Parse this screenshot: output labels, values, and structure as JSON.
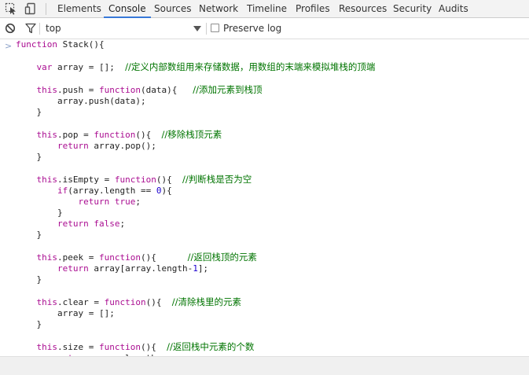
{
  "devtools": {
    "tabs": [
      {
        "label": "Elements"
      },
      {
        "label": "Console",
        "active": true
      },
      {
        "label": "Sources"
      },
      {
        "label": "Network"
      },
      {
        "label": "Timeline"
      },
      {
        "label": "Profiles"
      },
      {
        "label": "Resources"
      },
      {
        "label": "Security"
      },
      {
        "label": "Audits"
      }
    ],
    "icons": [
      "inspect-element-icon",
      "device-mode-icon"
    ]
  },
  "console_toolbar": {
    "context": "top",
    "preserve_log_label": "Preserve log",
    "preserve_log_checked": false,
    "icons": [
      "clear-console-icon",
      "filter-icon",
      "dropdown-arrow-icon"
    ]
  },
  "console": {
    "lines": [
      [
        {
          "t": "function",
          "c": "kw"
        },
        {
          "t": " Stack(){"
        }
      ],
      [],
      [
        {
          "t": "    "
        },
        {
          "t": "var",
          "c": "kw"
        },
        {
          "t": " array = [];  "
        },
        {
          "t": "//定义内部数组用来存储数据，用数组的末端来模拟堆栈的顶端",
          "c": "cm"
        }
      ],
      [],
      [
        {
          "t": "    "
        },
        {
          "t": "this",
          "c": "kw"
        },
        {
          "t": ".push = "
        },
        {
          "t": "function",
          "c": "kw"
        },
        {
          "t": "(data){   "
        },
        {
          "t": "//添加元素到栈顶",
          "c": "cm"
        }
      ],
      [
        {
          "t": "        array.push(data);"
        }
      ],
      [
        {
          "t": "    }"
        }
      ],
      [],
      [
        {
          "t": "    "
        },
        {
          "t": "this",
          "c": "kw"
        },
        {
          "t": ".pop = "
        },
        {
          "t": "function",
          "c": "kw"
        },
        {
          "t": "(){  "
        },
        {
          "t": "//移除栈顶元素",
          "c": "cm"
        }
      ],
      [
        {
          "t": "        "
        },
        {
          "t": "return",
          "c": "kw"
        },
        {
          "t": " array.pop();"
        }
      ],
      [
        {
          "t": "    }"
        }
      ],
      [],
      [
        {
          "t": "    "
        },
        {
          "t": "this",
          "c": "kw"
        },
        {
          "t": ".isEmpty = "
        },
        {
          "t": "function",
          "c": "kw"
        },
        {
          "t": "(){  "
        },
        {
          "t": "//判断栈是否为空",
          "c": "cm"
        }
      ],
      [
        {
          "t": "        "
        },
        {
          "t": "if",
          "c": "kw"
        },
        {
          "t": "(array.length == "
        },
        {
          "t": "0",
          "c": "num"
        },
        {
          "t": "){"
        }
      ],
      [
        {
          "t": "            "
        },
        {
          "t": "return",
          "c": "kw"
        },
        {
          "t": " "
        },
        {
          "t": "true",
          "c": "kw"
        },
        {
          "t": ";"
        }
      ],
      [
        {
          "t": "        }"
        }
      ],
      [
        {
          "t": "        "
        },
        {
          "t": "return",
          "c": "kw"
        },
        {
          "t": " "
        },
        {
          "t": "false",
          "c": "kw"
        },
        {
          "t": ";"
        }
      ],
      [
        {
          "t": "    }"
        }
      ],
      [],
      [
        {
          "t": "    "
        },
        {
          "t": "this",
          "c": "kw"
        },
        {
          "t": ".peek = "
        },
        {
          "t": "function",
          "c": "kw"
        },
        {
          "t": "(){      "
        },
        {
          "t": "//返回栈顶的元素",
          "c": "cm"
        }
      ],
      [
        {
          "t": "        "
        },
        {
          "t": "return",
          "c": "kw"
        },
        {
          "t": " array[array.length-"
        },
        {
          "t": "1",
          "c": "num"
        },
        {
          "t": "];"
        }
      ],
      [
        {
          "t": "    }"
        }
      ],
      [],
      [
        {
          "t": "    "
        },
        {
          "t": "this",
          "c": "kw"
        },
        {
          "t": ".clear = "
        },
        {
          "t": "function",
          "c": "kw"
        },
        {
          "t": "(){  "
        },
        {
          "t": "//清除栈里的元素",
          "c": "cm"
        }
      ],
      [
        {
          "t": "        array = [];"
        }
      ],
      [
        {
          "t": "    }"
        }
      ],
      [],
      [
        {
          "t": "    "
        },
        {
          "t": "this",
          "c": "kw"
        },
        {
          "t": ".size = "
        },
        {
          "t": "function",
          "c": "kw"
        },
        {
          "t": "(){  "
        },
        {
          "t": "//返回栈中元素的个数",
          "c": "cm"
        }
      ],
      [
        {
          "t": "        "
        },
        {
          "t": "return",
          "c": "kw"
        },
        {
          "t": " array.length;"
        }
      ]
    ]
  },
  "colors": {
    "keyword": "#aa0d91",
    "number": "#1c00cf",
    "comment": "#007400",
    "active_tab_underline": "#3879d9"
  }
}
